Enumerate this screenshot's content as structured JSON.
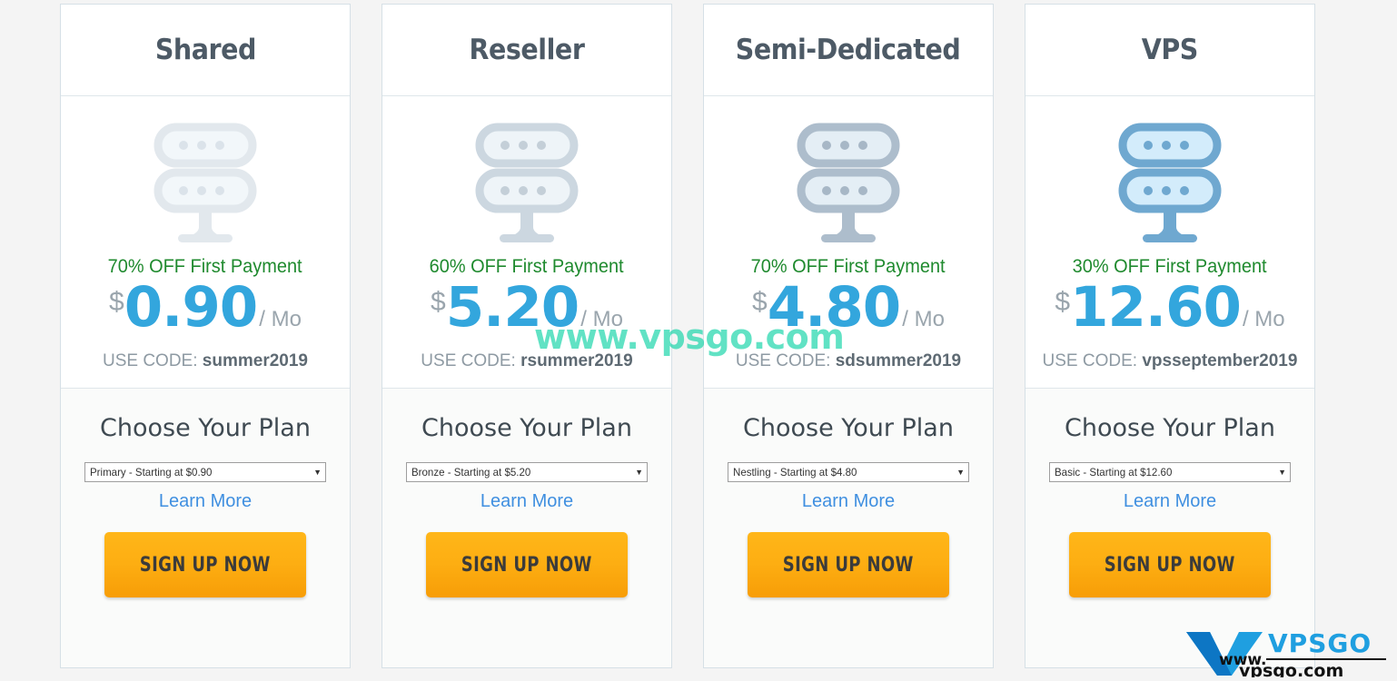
{
  "page": {
    "watermark": "www.vpsgo.com",
    "background_color": "#f4f4f4",
    "accent_price_color": "#33a6dd",
    "discount_color": "#1f8a2e",
    "link_color": "#3f8fe0",
    "button_color": "#fdae12"
  },
  "logo": {
    "mark_letter": "V",
    "wordmark": "VPSGO",
    "prefix": "www.",
    "domain": "vpsgo.com"
  },
  "plans": [
    {
      "title": "Shared",
      "icon": "server-icon",
      "icon_stroke": "#e2e8ed",
      "icon_fill": "#f2f7fa",
      "icon_dot": "#dbe3ea",
      "discount": "70% OFF First Payment",
      "currency": "$",
      "price": "0.90",
      "period": "/ Mo",
      "promo_label": "USE CODE:",
      "promo_code": "summer2019",
      "choose_title": "Choose Your Plan",
      "select_value": "Primary - Starting at $0.90",
      "select_arrow": "▼",
      "learn_more": "Learn More",
      "signup_label": "SIGN UP NOW"
    },
    {
      "title": "Reseller",
      "icon": "server-icon",
      "icon_stroke": "#ccd7e0",
      "icon_fill": "#eef4f8",
      "icon_dot": "#c4cfd8",
      "discount": "60% OFF First Payment",
      "currency": "$",
      "price": "5.20",
      "period": "/ Mo",
      "promo_label": "USE CODE:",
      "promo_code": "rsummer2019",
      "choose_title": "Choose Your Plan",
      "select_value": "Bronze - Starting at $5.20",
      "select_arrow": "▼",
      "learn_more": "Learn More",
      "signup_label": "SIGN UP NOW"
    },
    {
      "title": "Semi-Dedicated",
      "icon": "server-icon",
      "icon_stroke": "#adbdcc",
      "icon_fill": "#e4eef5",
      "icon_dot": "#a7b7c6",
      "discount": "70% OFF First Payment",
      "currency": "$",
      "price": "4.80",
      "period": "/ Mo",
      "promo_label": "USE CODE:",
      "promo_code": "sdsummer2019",
      "choose_title": "Choose Your Plan",
      "select_value": "Nestling - Starting at $4.80",
      "select_arrow": "▼",
      "learn_more": "Learn More",
      "signup_label": "SIGN UP NOW"
    },
    {
      "title": "VPS",
      "icon": "server-icon",
      "icon_stroke": "#6fa8d0",
      "icon_fill": "#d3ecfb",
      "icon_dot": "#6fa8d0",
      "discount": "30% OFF First Payment",
      "currency": "$",
      "price": "12.60",
      "period": "/ Mo",
      "promo_label": "USE CODE:",
      "promo_code": "vpsseptember2019",
      "choose_title": "Choose Your Plan",
      "select_value": "Basic - Starting at $12.60",
      "select_arrow": "▼",
      "learn_more": "Learn More",
      "signup_label": "SIGN UP NOW"
    }
  ]
}
